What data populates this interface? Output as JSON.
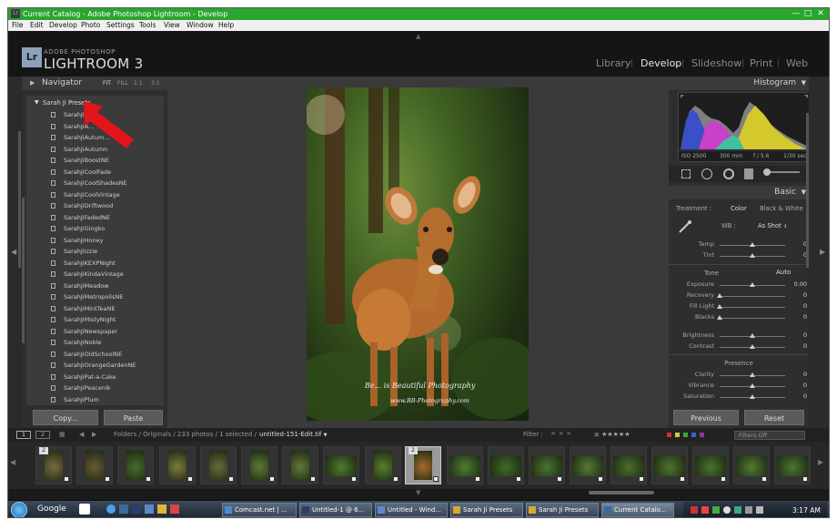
{
  "window": {
    "title": "Current Catalog - Adobe Photoshop Lightroom - Develop",
    "app_icon": "Lr"
  },
  "menu": [
    "File",
    "Edit",
    "Develop",
    "Photo",
    "Settings",
    "Tools",
    "View",
    "Window",
    "Help"
  ],
  "brand": {
    "small": "ADOBE PHOTOSHOP",
    "big": "LIGHTROOM 3",
    "icon": "Lr"
  },
  "modules": [
    "Library",
    "Develop",
    "Slideshow",
    "Print",
    "Web"
  ],
  "left_panel": {
    "navigator": {
      "title": "Navigator",
      "zoom": [
        "FIT",
        "FILL",
        "1:1",
        "3:1"
      ]
    },
    "preset_folder": "Sarah Ji Presets",
    "presets": [
      "SarahJiTNE",
      "SarahJiA...",
      "SarahJiAutum...",
      "SarahJiAutumn",
      "SarahJiBoostNE",
      "SarahJiCoolFade",
      "SarahJiCoolShadesNE",
      "SarahJiCoolVintage",
      "SarahJiDriftwood",
      "SarahJiFadedNE",
      "SarahJiGingko",
      "SarahJiHoney",
      "SarahJiIzzie",
      "SarahJiKEXPNight",
      "SarahJiKindaVintage",
      "SarahJiMeadow",
      "SarahJiMetropolisNE",
      "SarahJiMintTeaNE",
      "SarahJiMistyNight",
      "SarahJiNewspaper",
      "SarahJiNoble",
      "SarahJiOldSchoolNE",
      "SarahJiOrangeGardenNE",
      "SarahJiPat-a-Cake",
      "SarahJiPeacenik",
      "SarahJiPlum"
    ],
    "copy_label": "Copy...",
    "paste_label": "Paste"
  },
  "photo": {
    "watermark": "Be... is Beautiful Photography",
    "watermark_url": "www.BB-Photography.com"
  },
  "right_panel": {
    "histogram_title": "Histogram",
    "camera_info": [
      "ISO 2500",
      "300 mm",
      "f / 5.6",
      "1/30 sec"
    ],
    "basic_title": "Basic",
    "treatment_label": "Treatment :",
    "treatment_options": [
      "Color",
      "Black & White"
    ],
    "wb_label": "WB :",
    "wb_value": "As Shot",
    "wb_sliders": [
      {
        "label": "Temp",
        "value": "0",
        "pos": 0.5
      },
      {
        "label": "Tint",
        "value": "0",
        "pos": 0.5
      }
    ],
    "tone_label": "Tone",
    "auto_label": "Auto",
    "tone_sliders": [
      {
        "label": "Exposure",
        "value": "0.00",
        "pos": 0.5
      },
      {
        "label": "Recovery",
        "value": "0",
        "pos": 0.0
      },
      {
        "label": "Fill Light",
        "value": "0",
        "pos": 0.0
      },
      {
        "label": "Blacks",
        "value": "0",
        "pos": 0.0
      },
      {
        "label": "Brightness",
        "value": "0",
        "pos": 0.5
      },
      {
        "label": "Contrast",
        "value": "0",
        "pos": 0.5
      }
    ],
    "presence_label": "Presence",
    "presence_sliders": [
      {
        "label": "Clarity",
        "value": "0",
        "pos": 0.5
      },
      {
        "label": "Vibrance",
        "value": "0",
        "pos": 0.5
      },
      {
        "label": "Saturation",
        "value": "0",
        "pos": 0.5
      }
    ],
    "previous_label": "Previous",
    "reset_label": "Reset"
  },
  "filmstrip_bar": {
    "page1": "1",
    "page2": "2",
    "path": "Folders / Originals / 233 photos / 1 selected /",
    "filename": "untitled-151-Edit.tif",
    "filter_label": "Filter :",
    "filters_off": "Filters Off"
  },
  "filmstrip": {
    "badge": "2",
    "selected_index": 9
  },
  "taskbar": {
    "items": [
      "Google",
      "Comcast.net | ...",
      "Untitled-1 @ 6...",
      "Untitled - Wind...",
      "Sarah Ji Presets",
      "Sarah Ji Presets",
      "Current Catalo..."
    ],
    "clock": "3:17 AM"
  },
  "colors": {
    "accent_green": "#2aa52f",
    "panel": "#2e2e2e",
    "arrow_red": "#e1151a"
  }
}
